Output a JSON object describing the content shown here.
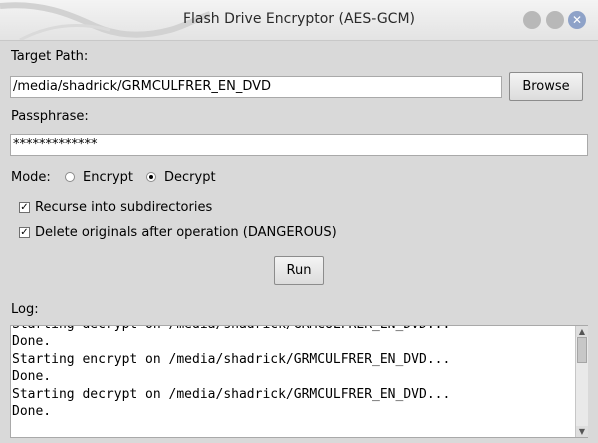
{
  "window": {
    "title": "Flash Drive Encryptor (AES-GCM)"
  },
  "target": {
    "label": "Target Path:",
    "value": "/media/shadrick/GRMCULFRER_EN_DVD",
    "browse_label": "Browse"
  },
  "passphrase": {
    "label": "Passphrase:",
    "value": "*************"
  },
  "mode": {
    "label": "Mode:",
    "encrypt_label": "Encrypt",
    "decrypt_label": "Decrypt",
    "selected": "Decrypt"
  },
  "options": {
    "recurse_label": "Recurse into subdirectories",
    "recurse_checked": true,
    "delete_label": "Delete originals after operation (DANGEROUS)",
    "delete_checked": true
  },
  "run_label": "Run",
  "log": {
    "label": "Log:",
    "text": "Starting decrypt on /media/shadrick/GRMCULFRER_EN_DVD...\nDone.\nStarting encrypt on /media/shadrick/GRMCULFRER_EN_DVD...\nDone.\nStarting decrypt on /media/shadrick/GRMCULFRER_EN_DVD...\nDone."
  }
}
